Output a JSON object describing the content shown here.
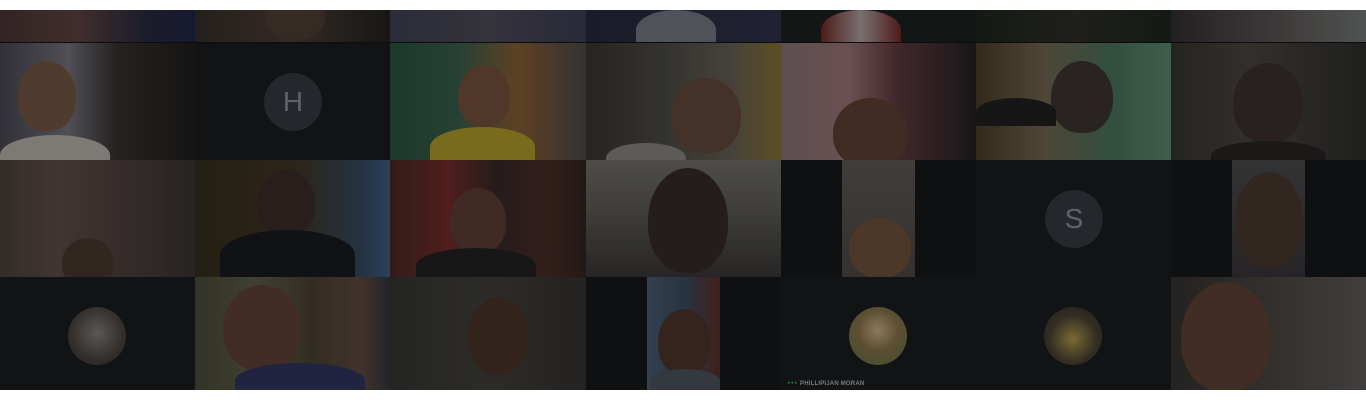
{
  "meeting": {
    "participants": [
      {
        "id": "p-r0-0",
        "kind": "video"
      },
      {
        "id": "p-r0-1",
        "kind": "video"
      },
      {
        "id": "p-r0-2",
        "kind": "video"
      },
      {
        "id": "p-r0-3",
        "kind": "video"
      },
      {
        "id": "p-r0-4",
        "kind": "video"
      },
      {
        "id": "p-r0-5",
        "kind": "video"
      },
      {
        "id": "p-r0-6",
        "kind": "video"
      },
      {
        "id": "p-r1-0",
        "kind": "video"
      },
      {
        "id": "p-r1-1",
        "kind": "avatar",
        "initial": "H"
      },
      {
        "id": "p-r1-2",
        "kind": "video"
      },
      {
        "id": "p-r1-3",
        "kind": "video"
      },
      {
        "id": "p-r1-4",
        "kind": "video"
      },
      {
        "id": "p-r1-5",
        "kind": "video"
      },
      {
        "id": "p-r1-6",
        "kind": "video"
      },
      {
        "id": "p-r2-0",
        "kind": "video"
      },
      {
        "id": "p-r2-1",
        "kind": "video"
      },
      {
        "id": "p-r2-2",
        "kind": "video"
      },
      {
        "id": "p-r2-3",
        "kind": "video"
      },
      {
        "id": "p-r2-4",
        "kind": "video"
      },
      {
        "id": "p-r2-5",
        "kind": "avatar",
        "initial": "S"
      },
      {
        "id": "p-r2-6",
        "kind": "video"
      },
      {
        "id": "p-r3-0",
        "kind": "avatar-photo"
      },
      {
        "id": "p-r3-1",
        "kind": "video"
      },
      {
        "id": "p-r3-2",
        "kind": "video"
      },
      {
        "id": "p-r3-3",
        "kind": "video"
      },
      {
        "id": "p-r3-4",
        "kind": "avatar-photo",
        "name": "PHILLIPIJAN MORAN",
        "speaking_indicator": "•••"
      },
      {
        "id": "p-r3-5",
        "kind": "avatar-photo"
      },
      {
        "id": "p-r3-6",
        "kind": "video"
      }
    ]
  },
  "colors": {
    "background": "#0d0e0f",
    "tile": "#151617",
    "avatar_bg": "#2a2d31",
    "avatar_text": "#6d7176",
    "speaking_green": "#3aa15a"
  },
  "icons": {
    "speaking": "audio-dots-icon"
  }
}
